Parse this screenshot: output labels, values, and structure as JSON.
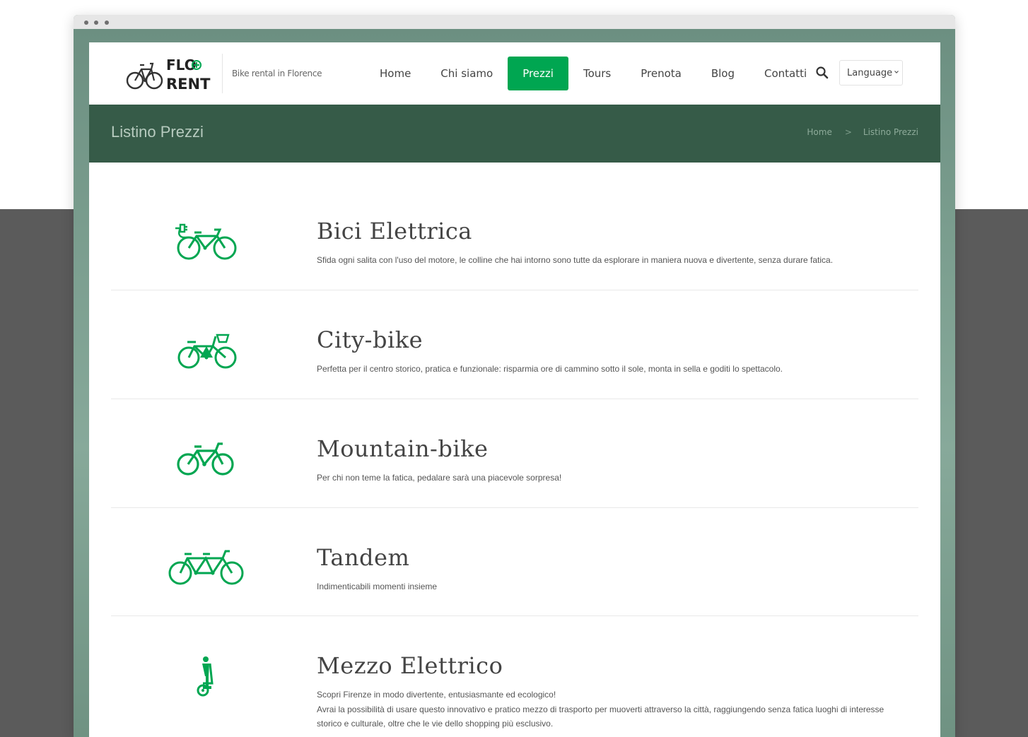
{
  "site": {
    "logo_text_line1": "FLO",
    "logo_text_line2": "RENT",
    "tagline": "Bike rental in Florence"
  },
  "nav": {
    "items": [
      {
        "label": "Home",
        "active": false
      },
      {
        "label": "Chi siamo",
        "active": false
      },
      {
        "label": "Prezzi",
        "active": true
      },
      {
        "label": "Tours",
        "active": false
      },
      {
        "label": "Prenota",
        "active": false
      },
      {
        "label": "Blog",
        "active": false
      },
      {
        "label": "Contatti",
        "active": false
      }
    ],
    "search_icon": "search-icon",
    "language_label": "Language"
  },
  "page_title": "Listino Prezzi",
  "breadcrumb": {
    "home": "Home",
    "separator": ">",
    "current": "Listino Prezzi"
  },
  "products": [
    {
      "title": "Bici Elettrica",
      "icon": "electric-bike-icon",
      "description": "Sfida ogni salita con l'uso del motore, le colline che hai intorno sono tutte da esplorare in maniera nuova e divertente, senza durare fatica."
    },
    {
      "title": "City-bike",
      "icon": "city-bike-icon",
      "description": "Perfetta per il centro storico, pratica e funzionale: risparmia ore di cammino sotto il sole, monta in sella e goditi lo spettacolo."
    },
    {
      "title": "Mountain-bike",
      "icon": "mountain-bike-icon",
      "description": "Per chi non teme la fatica, pedalare sarà una piacevole sorpresa!"
    },
    {
      "title": "Tandem",
      "icon": "tandem-bike-icon",
      "description": "Indimenticabili momenti insieme"
    },
    {
      "title": "Mezzo Elettrico",
      "icon": "segway-icon",
      "description_line1": "Scopri Firenze in modo divertente, entusiasmante ed ecologico!",
      "description_line2": "Avrai la possibilità di usare questo innovativo e pratico mezzo di trasporto per muoverti attraverso la città, raggiungendo senza fatica luoghi di interesse storico e culturale, oltre che le vie dello shopping più esclusivo."
    }
  ],
  "colors": {
    "brand_green": "#00a651",
    "title_band": "#365b48",
    "browser_frame": "#7a9d8e"
  }
}
